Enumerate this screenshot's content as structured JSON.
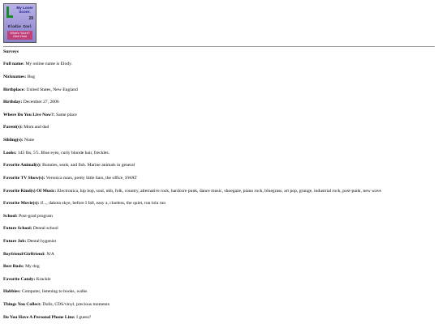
{
  "badge": {
    "line1": "My Loser",
    "line2": "Score:",
    "score": "28",
    "name": "Elodie Cool",
    "cta1": "What's Yours?",
    "cta2": "Click Here"
  },
  "section_title": "Surveys",
  "rows": [
    {
      "label": "Full name:",
      "value": "My online name is Elody."
    },
    {
      "label": "Nicknames:",
      "value": "Bug"
    },
    {
      "label": "Birthplace:",
      "value": "United States, New England"
    },
    {
      "label": "Birthday:",
      "value": "December 27, 2006"
    },
    {
      "label": "Where Do You Live Now?:",
      "value": "Same place"
    },
    {
      "label": "Parent(s):",
      "value": "Mom and dad"
    },
    {
      "label": "Sibling(s):",
      "value": "None"
    },
    {
      "label": "Looks:",
      "value": "145 lbs, 5'5. Blue eyes, curly blonde hair, freckles."
    },
    {
      "label": "Favorite Animal(s):",
      "value": "Bunnies, seals, and fish. Marine animals in general"
    },
    {
      "label": "Favorite TV Show(s):",
      "value": "Veronica mars, pretty little liars, the office, SWAT"
    },
    {
      "label": "Favorite Kind(s) Of Music:",
      "value": "Electronica, hip hop, soul, nkb, folk, country, alternative rock, hardcore punk, dance music, shoegaze, piano rock, bluegrass, art pop, grunge, industrial rock, post-punk, new wave"
    },
    {
      "label": "Favorite Movie(s):",
      "value": "if..., dakota skye, before I fall, easy a, clueless, the quiet, run lola run"
    },
    {
      "label": "School:",
      "value": "Post-grad program"
    },
    {
      "label": "Future School:",
      "value": "Dental school"
    },
    {
      "label": "Future Job:",
      "value": "Dental hygenist"
    },
    {
      "label": "Boyfriend/Girlfriend:",
      "value": "N/A"
    },
    {
      "label": "Best Buds:",
      "value": "My dog"
    },
    {
      "label": "Favorite Candy:",
      "value": "Krackle"
    },
    {
      "label": "Hobbies:",
      "value": "Computer, listening to books, walks"
    },
    {
      "label": "Things You Collect:",
      "value": "Dolls, CDS/vinyl, precious moments"
    },
    {
      "label": "Do You Have A Personal Phone Line:",
      "value": "I guess?"
    }
  ]
}
